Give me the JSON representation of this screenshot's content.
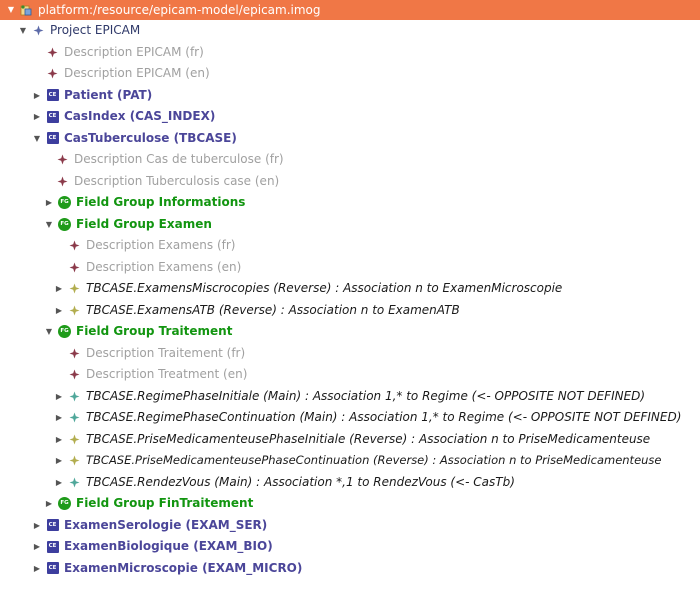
{
  "colors": {
    "selection": "#f07746",
    "entity_label": "#4b4699",
    "field_group_label": "#129510",
    "description_label": "#a0a0a0",
    "entity_badge": "#3d3e9e",
    "field_group_badge": "#1f9b1a",
    "description_star": "#8b3a4a",
    "association_star_yellow": "#b2ad4e",
    "association_star_teal": "#4fa79a"
  },
  "icons": {
    "ce_badge": "CE",
    "fg_badge": "FG"
  },
  "tree": {
    "root": "platform:/resource/epicam-model/epicam.imog",
    "project": "Project EPICAM",
    "project_desc_fr": "Description EPICAM (fr)",
    "project_desc_en": "Description EPICAM (en)",
    "patient": "Patient (PAT)",
    "casindex": "CasIndex (CAS_INDEX)",
    "castuberculose": "CasTuberculose (TBCASE)",
    "tbcase_desc_fr": "Description Cas de tuberculose (fr)",
    "tbcase_desc_en": "Description Tuberculosis case (en)",
    "fg_informations": "Field Group Informations",
    "fg_examen": "Field Group Examen",
    "examen_desc_fr": "Description Examens (fr)",
    "examen_desc_en": "Description Examens (en)",
    "assoc_microscopies": "TBCASE.ExamensMiscrocopies (Reverse) : Association n to  ExamenMicroscopie",
    "assoc_atb": "TBCASE.ExamensATB (Reverse) : Association n to  ExamenATB",
    "fg_traitement": "Field Group Traitement",
    "traitement_desc_fr": "Description Traitement (fr)",
    "traitement_desc_en": "Description Treatment (en)",
    "assoc_regime_initiale": "TBCASE.RegimePhaseInitiale (Main) : Association 1,* to  Regime (<- OPPOSITE NOT DEFINED)",
    "assoc_regime_continuation": "TBCASE.RegimePhaseContinuation (Main) : Association 1,* to  Regime (<- OPPOSITE NOT DEFINED)",
    "assoc_prise_initiale": "TBCASE.PriseMedicamenteusePhaseInitiale (Reverse) : Association n to  PriseMedicamenteuse",
    "assoc_prise_continuation": "TBCASE.PriseMedicamenteusePhaseContinuation (Reverse) : Association n to  PriseMedicamenteuse",
    "assoc_rendezvous": "TBCASE.RendezVous (Main) : Association *,1 to  RendezVous (<- CasTb)",
    "fg_fintraitement": "Field Group FinTraitement",
    "examen_serologie": "ExamenSerologie (EXAM_SER)",
    "examen_biologique": "ExamenBiologique (EXAM_BIO)",
    "examen_microscopie": "ExamenMicroscopie (EXAM_MICRO)"
  }
}
